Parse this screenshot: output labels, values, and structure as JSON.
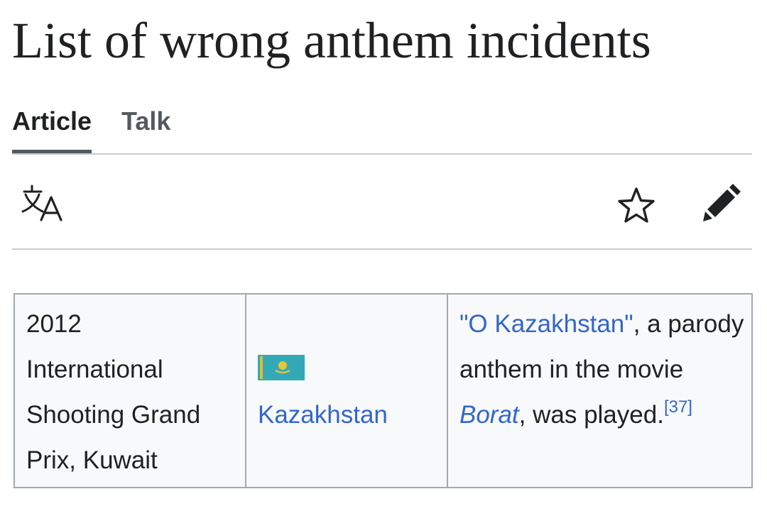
{
  "page": {
    "title": "List of wrong anthem incidents"
  },
  "tabs": [
    {
      "label": "Article",
      "active": true
    },
    {
      "label": "Talk",
      "active": false
    }
  ],
  "toolbar": {
    "language_icon": "translate-icon",
    "watch_icon": "star-icon",
    "edit_icon": "pencil-icon"
  },
  "table": {
    "row": {
      "event_lines": [
        "2012",
        "International",
        "Shooting Grand",
        "Prix, Kuwait"
      ],
      "flag_icon": "kazakhstan-flag-icon",
      "country": "Kazakhstan",
      "description": {
        "anthem_link": "\"O Kazakhstan\"",
        "after_anthem": ", a parody anthem in the movie ",
        "movie_link": "Borat",
        "after_movie": ", was played.",
        "reference": "[37]"
      }
    }
  },
  "colors": {
    "link": "#3366cc",
    "text": "#202122",
    "tab_inactive": "#54595d",
    "border": "#a2a9b1",
    "table_background": "#f8f9fa",
    "flag_teal": "#33a9b8",
    "flag_gold": "#e8c53a"
  }
}
